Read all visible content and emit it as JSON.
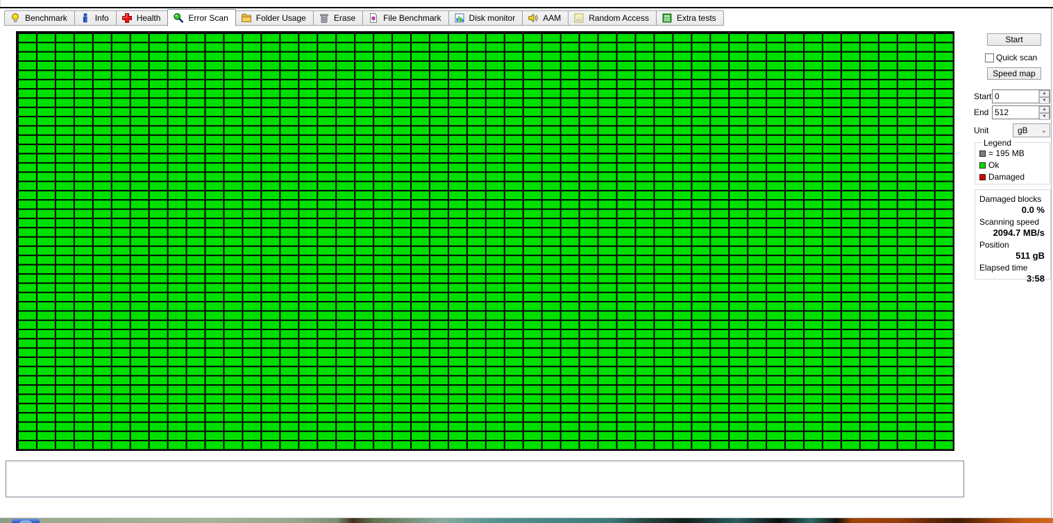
{
  "tabs": {
    "items": [
      {
        "label": "Benchmark",
        "icon": "lightbulb-icon",
        "active": false
      },
      {
        "label": "Info",
        "icon": "info-icon",
        "active": false
      },
      {
        "label": "Health",
        "icon": "health-cross-icon",
        "active": false
      },
      {
        "label": "Error Scan",
        "icon": "magnifier-icon",
        "active": true
      },
      {
        "label": "Folder Usage",
        "icon": "folder-icon",
        "active": false
      },
      {
        "label": "Erase",
        "icon": "trash-icon",
        "active": false
      },
      {
        "label": "File Benchmark",
        "icon": "file-icon",
        "active": false
      },
      {
        "label": "Disk monitor",
        "icon": "bar-chart-icon",
        "active": false
      },
      {
        "label": "AAM",
        "icon": "speaker-icon",
        "active": false
      },
      {
        "label": "Random Access",
        "icon": "random-dots-icon",
        "active": false
      },
      {
        "label": "Extra tests",
        "icon": "extra-tests-icon",
        "active": false
      }
    ]
  },
  "error_scan": {
    "grid": {
      "cols": 50,
      "rows": 45,
      "all_blocks_status": "ok",
      "ok_color": "#00e000",
      "damaged_color": "#dd0000",
      "line_color": "#000000"
    },
    "controls": {
      "start_button": "Start",
      "quick_scan_label": "Quick scan",
      "quick_scan_checked": false,
      "speed_map_button": "Speed map",
      "start_label": "Start",
      "start_value": "0",
      "end_label": "End",
      "end_value": "512",
      "unit_label": "Unit",
      "unit_value": "gB"
    },
    "legend": {
      "title": "Legend",
      "block_size_label": "= 195 MB",
      "ok_label": "Ok",
      "damaged_label": "Damaged",
      "block_swatch_color": "#808080",
      "ok_swatch_color": "#00dd00",
      "damaged_swatch_color": "#dd0000"
    },
    "stats": {
      "damaged_blocks_label": "Damaged blocks",
      "damaged_blocks_value": "0.0 %",
      "scanning_speed_label": "Scanning speed",
      "scanning_speed_value": "2094.7 MB/s",
      "position_label": "Position",
      "position_value": "511 gB",
      "elapsed_time_label": "Elapsed time",
      "elapsed_time_value": "3:58"
    }
  }
}
